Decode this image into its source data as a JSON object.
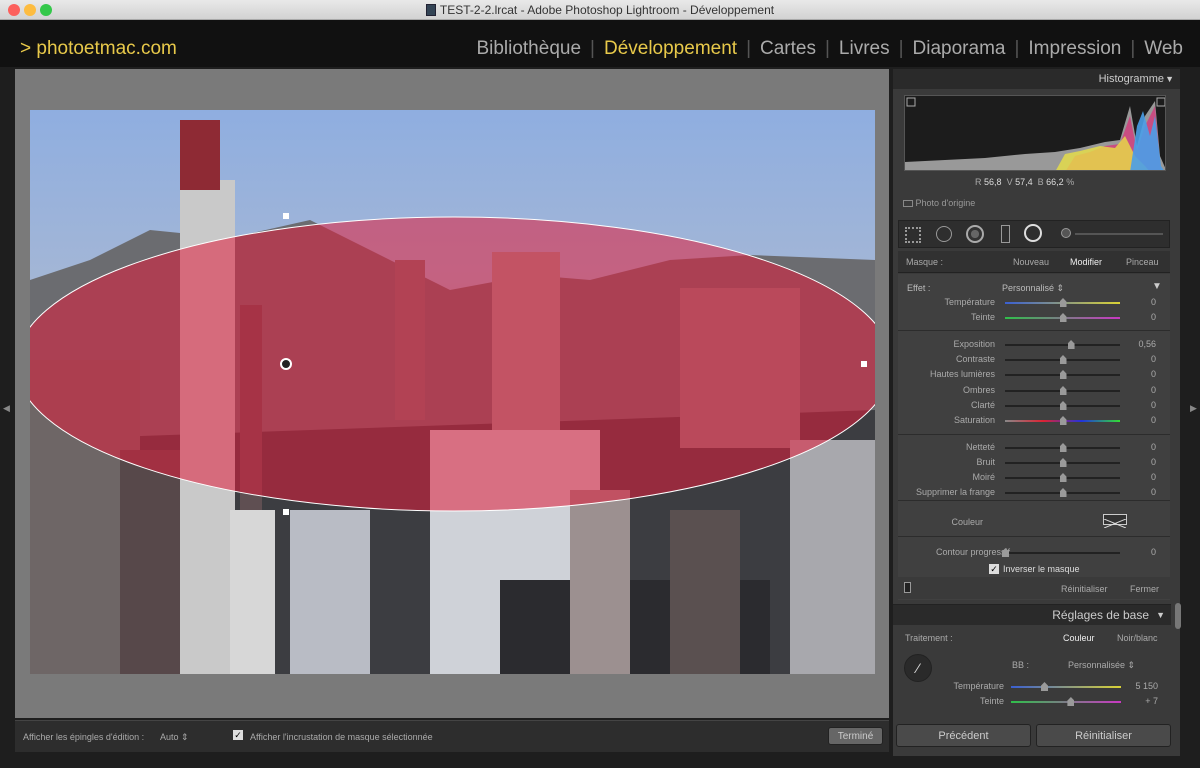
{
  "window": {
    "title": "TEST-2-2.lrcat - Adobe Photoshop Lightroom - Développement"
  },
  "header": {
    "logo": "> photoetmac.com",
    "modules": [
      "Bibliothèque",
      "Développement",
      "Cartes",
      "Livres",
      "Diaporama",
      "Impression",
      "Web"
    ],
    "active": "Développement"
  },
  "toolbar": {
    "pins_label": "Afficher les épingles d'édition :",
    "pins_value": "Auto",
    "overlay_label": "Afficher l'incrustation de masque sélectionnée",
    "done": "Terminé"
  },
  "histogram": {
    "title": "Histogramme",
    "r_label": "R",
    "r_value": "56,8",
    "v_label": "V",
    "v_value": "57,4",
    "b_label": "B",
    "b_value": "66,2",
    "unit": "%",
    "original": "Photo d'origine"
  },
  "mask": {
    "label": "Masque :",
    "new": "Nouveau",
    "edit": "Modifier",
    "brush": "Pinceau",
    "effect_label": "Effet :",
    "effect_value": "Personnalisé",
    "sliders1": [
      {
        "label": "Température",
        "value": "0",
        "pos": 0.5,
        "grad": "blue-yellow"
      },
      {
        "label": "Teinte",
        "value": "0",
        "pos": 0.5,
        "grad": "green-magenta"
      }
    ],
    "sliders2": [
      {
        "label": "Exposition",
        "value": "0,56",
        "pos": 0.57
      },
      {
        "label": "Contraste",
        "value": "0",
        "pos": 0.5
      },
      {
        "label": "Hautes lumières",
        "value": "0",
        "pos": 0.5
      },
      {
        "label": "Ombres",
        "value": "0",
        "pos": 0.5
      },
      {
        "label": "Clarté",
        "value": "0",
        "pos": 0.5
      },
      {
        "label": "Saturation",
        "value": "0",
        "pos": 0.5,
        "grad": "sat"
      }
    ],
    "sliders3": [
      {
        "label": "Netteté",
        "value": "0",
        "pos": 0.5
      },
      {
        "label": "Bruit",
        "value": "0",
        "pos": 0.5
      },
      {
        "label": "Moiré",
        "value": "0",
        "pos": 0.5
      },
      {
        "label": "Supprimer la frange",
        "value": "0",
        "pos": 0.5
      }
    ],
    "color_label": "Couleur",
    "feather_label": "Contour progressif",
    "feather_value": "0",
    "feather_pos": 0,
    "invert_label": "Inverser le masque",
    "reset": "Réinitialiser",
    "close": "Fermer"
  },
  "basic": {
    "title": "Réglages de base",
    "treatment_label": "Traitement :",
    "color": "Couleur",
    "bw": "Noir/blanc",
    "wb_label": "BB :",
    "wb_value": "Personnalisée",
    "temp_label": "Température",
    "temp_value": "5 150",
    "temp_pos": 0.3,
    "tint_label": "Teinte",
    "tint_value": "+ 7",
    "tint_pos": 0.54
  },
  "footer": {
    "previous": "Précédent",
    "reset": "Réinitialiser"
  },
  "colors": {
    "accent": "#e8c94a",
    "mask": "#e01e3c"
  }
}
